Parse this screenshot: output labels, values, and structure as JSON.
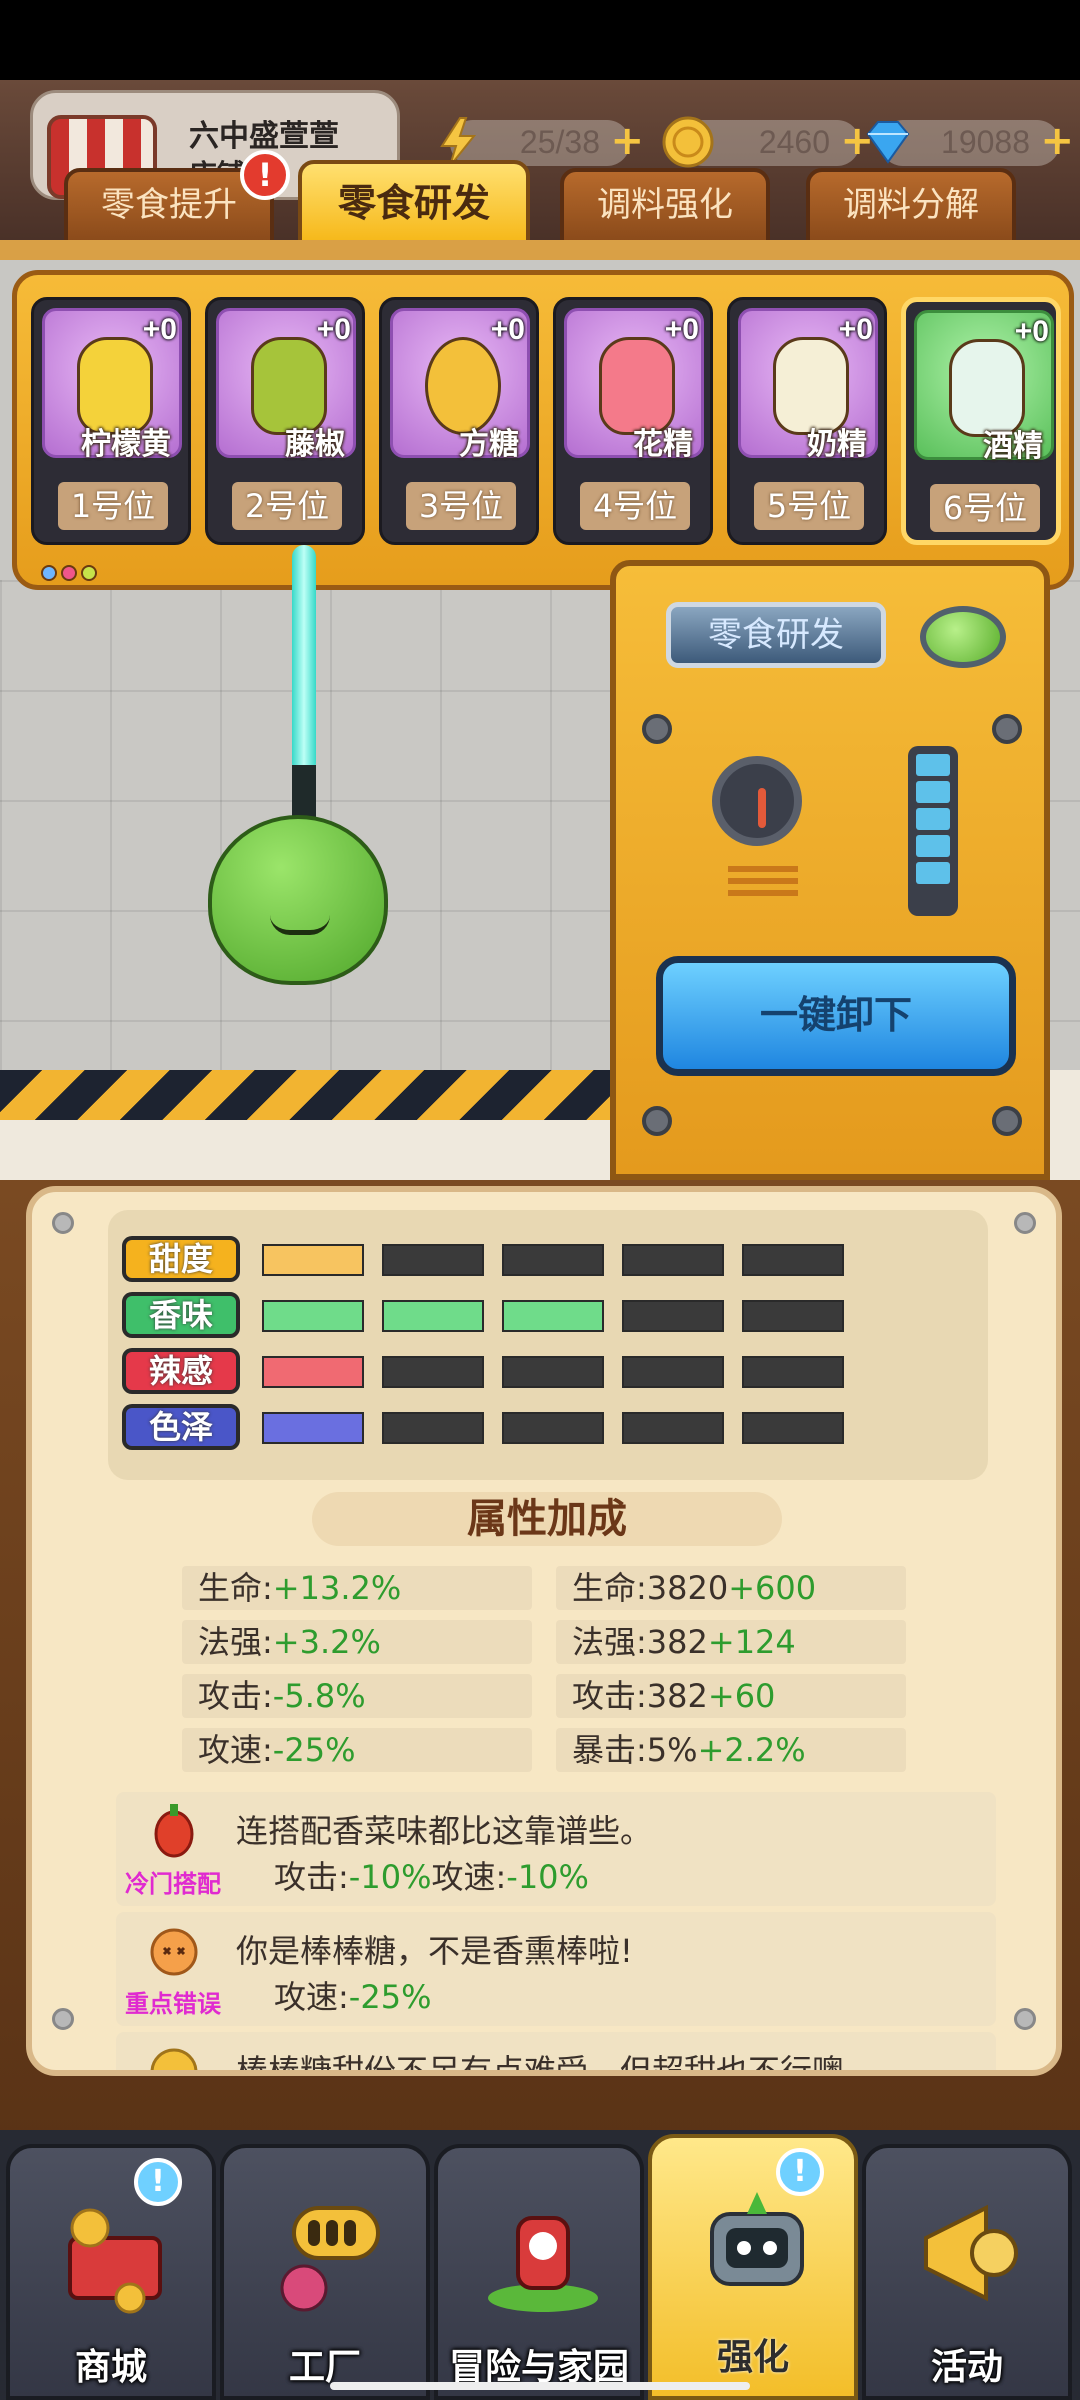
{
  "header": {
    "shop_name": "六中盛萱萱",
    "shop_sub": "店铺:",
    "resources": [
      {
        "name": "energy",
        "icon": "lightning-icon",
        "value": "25/38"
      },
      {
        "name": "coins",
        "icon": "coin-icon",
        "value": "2460"
      },
      {
        "name": "diamonds",
        "icon": "diamond-icon",
        "value": "19088"
      }
    ]
  },
  "tabs": [
    {
      "label": "零食提升",
      "active": false,
      "notice": "!"
    },
    {
      "label": "零食研发",
      "active": true
    },
    {
      "label": "调料强化",
      "active": false
    },
    {
      "label": "调料分解",
      "active": false
    }
  ],
  "slots": [
    {
      "name": "柠檬黄",
      "level": "+0",
      "position": "1号位",
      "color": "#f4d23a"
    },
    {
      "name": "藤椒",
      "level": "+0",
      "position": "2号位",
      "color": "#a6c43a"
    },
    {
      "name": "方糖",
      "level": "+0",
      "position": "3号位",
      "color": "#f3c03a"
    },
    {
      "name": "花精",
      "level": "+0",
      "position": "4号位",
      "color": "#f47a8a"
    },
    {
      "name": "奶精",
      "level": "+0",
      "position": "5号位",
      "color": "#f5efd6"
    },
    {
      "name": "酒精",
      "level": "+0",
      "position": "6号位",
      "color": "#e6f5ec"
    }
  ],
  "machine": {
    "sign": "零食研发",
    "unload_button": "一键卸下"
  },
  "attributes": [
    {
      "label": "甜度",
      "color": "#f5b21e",
      "filled": 1,
      "bar_color": "#f7c460"
    },
    {
      "label": "香味",
      "color": "#3fbf6a",
      "filled": 3,
      "bar_color": "#6fdc8a"
    },
    {
      "label": "辣感",
      "color": "#e5394a",
      "filled": 1,
      "bar_color": "#f06a72"
    },
    {
      "label": "色泽",
      "color": "#4a56c8",
      "filled": 1,
      "bar_color": "#6a6fe0"
    }
  ],
  "bonus": {
    "title": "属性加成",
    "left": [
      {
        "label": "生命:",
        "value": "+13.2%"
      },
      {
        "label": "法强:",
        "value": "+3.2%"
      },
      {
        "label": "攻击:",
        "value": "-5.8%"
      },
      {
        "label": "攻速:",
        "value": "-25%"
      }
    ],
    "right": [
      {
        "label": "生命:3820",
        "value": "+600"
      },
      {
        "label": "法强:382",
        "value": "+124"
      },
      {
        "label": "攻击:382",
        "value": "+60"
      },
      {
        "label": "暴击:5%",
        "value": "+2.2%"
      }
    ]
  },
  "combos": [
    {
      "tag": "冷门搭配",
      "text": "连搭配香菜味都比这靠谱些。",
      "eff1_label": "攻击:",
      "eff1_value": "-10%",
      "eff2_label": "攻速:",
      "eff2_value": "-10%"
    },
    {
      "tag": "重点错误",
      "text": "你是棒棒糖，不是香熏棒啦!",
      "eff1_label": "攻速:",
      "eff1_value": "-25%",
      "eff2_label": "",
      "eff2_value": ""
    },
    {
      "tag": "",
      "text": "棒棒糖甜份不足有点难受，但超甜也不行噢",
      "eff1_label": "",
      "eff1_value": "",
      "eff2_label": "",
      "eff2_value": ""
    }
  ],
  "nav": [
    {
      "label": "商城",
      "badge": "!",
      "active": false
    },
    {
      "label": "工厂",
      "badge": "",
      "active": false
    },
    {
      "label": "冒险与家园",
      "badge": "",
      "active": false
    },
    {
      "label": "强化",
      "badge": "!",
      "active": true
    },
    {
      "label": "活动",
      "badge": "",
      "active": false
    }
  ]
}
